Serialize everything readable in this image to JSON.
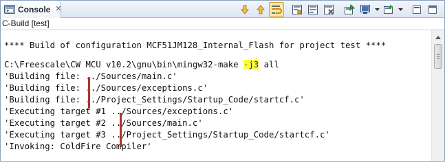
{
  "tab": {
    "label": "Console",
    "close_glyph": "✕"
  },
  "toolbar": {
    "buttons": [
      {
        "icon": "arrow-down-icon"
      },
      {
        "icon": "arrow-up-icon"
      },
      {
        "icon": "word-wrap-icon",
        "active": true
      },
      {
        "icon": "scroll-lock-icon"
      },
      {
        "icon": "clear-console-icon"
      },
      {
        "icon": "remove-launch-icon"
      },
      {
        "icon": "pin-console-icon"
      },
      {
        "icon": "display-console-icon"
      },
      {
        "icon": "open-console-icon"
      },
      {
        "icon": "minimize-icon"
      },
      {
        "icon": "maximize-icon"
      }
    ]
  },
  "subheader": "C-Build [test]",
  "console": {
    "header_line": "**** Build of configuration MCF51JM128_Internal_Flash for project test ****",
    "command_prefix": "C:\\Freescale\\CW MCU v10.2\\gnu\\bin\\mingw32-make ",
    "command_flag": "-j3",
    "command_suffix": " all",
    "lines": [
      "'Building file: ../Sources/main.c'",
      "'Building file: ../Sources/exceptions.c'",
      "'Building file: ../Project_Settings/Startup_Code/startcf.c'",
      "'Executing target #1 ../Sources/exceptions.c'",
      "'Executing target #2 ../Sources/main.c'",
      "'Executing target #3 ../Project_Settings/Startup_Code/startcf.c'",
      "'Invoking: ColdFire Compiler'"
    ]
  },
  "colors": {
    "highlight": "#ffff33",
    "annotation_bar": "#b0322a",
    "active_button": "#fde9a8"
  }
}
